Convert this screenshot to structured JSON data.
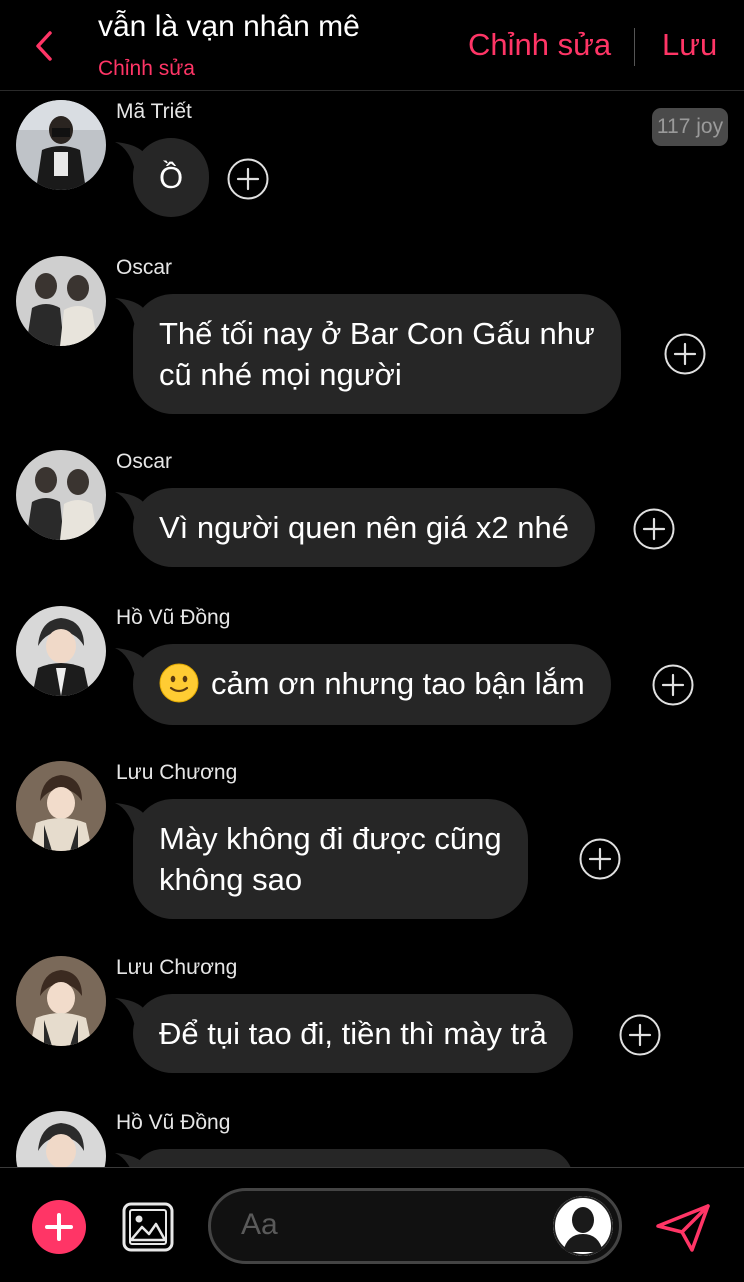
{
  "header": {
    "title": "vẫn là vạn nhân mê",
    "subtitle": "Chỉnh sửa",
    "edit_label": "Chỉnh sửa",
    "save_label": "Lưu"
  },
  "messages": [
    {
      "sender": "Mã Triết",
      "text": "Ồ",
      "badge": "117 joy"
    },
    {
      "sender": "Oscar",
      "line1": "Thế tối nay ở Bar Con Gấu như",
      "line2": "cũ nhé mọi người"
    },
    {
      "sender": "Oscar",
      "text": "Vì người quen nên giá x2 nhé"
    },
    {
      "sender": "Hồ Vũ Đồng",
      "text": "cảm ơn nhưng tao bận lắm",
      "emoji": "slightly-smiling-face-icon"
    },
    {
      "sender": "Lưu Chương",
      "line1": "Mày không đi được cũng",
      "line2": "không sao"
    },
    {
      "sender": "Lưu Chương",
      "text": "Để tụi tao đi, tiền thì mày trả"
    },
    {
      "sender": "Hồ Vũ Đồng",
      "text": ""
    }
  ],
  "composer": {
    "placeholder": "Aa"
  },
  "colors": {
    "accent": "#ff3566",
    "bubble": "#262626",
    "background": "#000000"
  }
}
